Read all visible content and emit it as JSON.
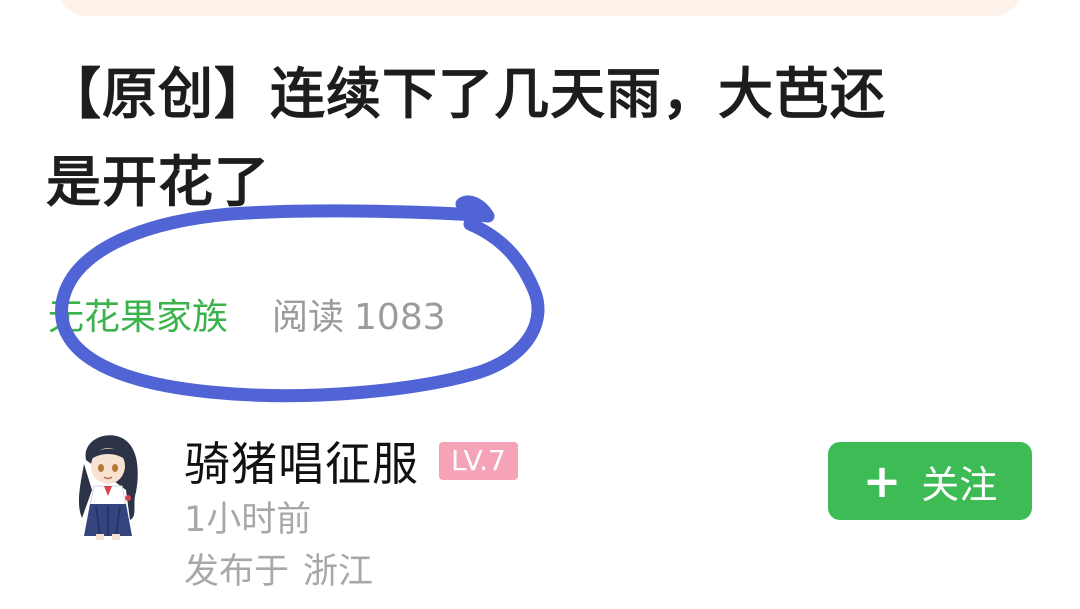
{
  "post": {
    "title_line1": "【原创】连续下了几天雨，大芭还",
    "title_line2": "是开花了",
    "group_name": "无花果家族",
    "read_label": "阅读",
    "read_count": "1083"
  },
  "author": {
    "name": "骑猪唱征服",
    "level": "LV.7",
    "time": "1小时前",
    "location_label": "发布于",
    "location": "浙江"
  },
  "follow_button": {
    "icon": "plus-icon",
    "label": "关注"
  },
  "colors": {
    "accent_green": "#3dbb55",
    "group_green": "#39b34a",
    "level_badge": "#f6a3b7",
    "annotation_stroke": "#5064d6",
    "top_banner": "#fdf2ea"
  }
}
